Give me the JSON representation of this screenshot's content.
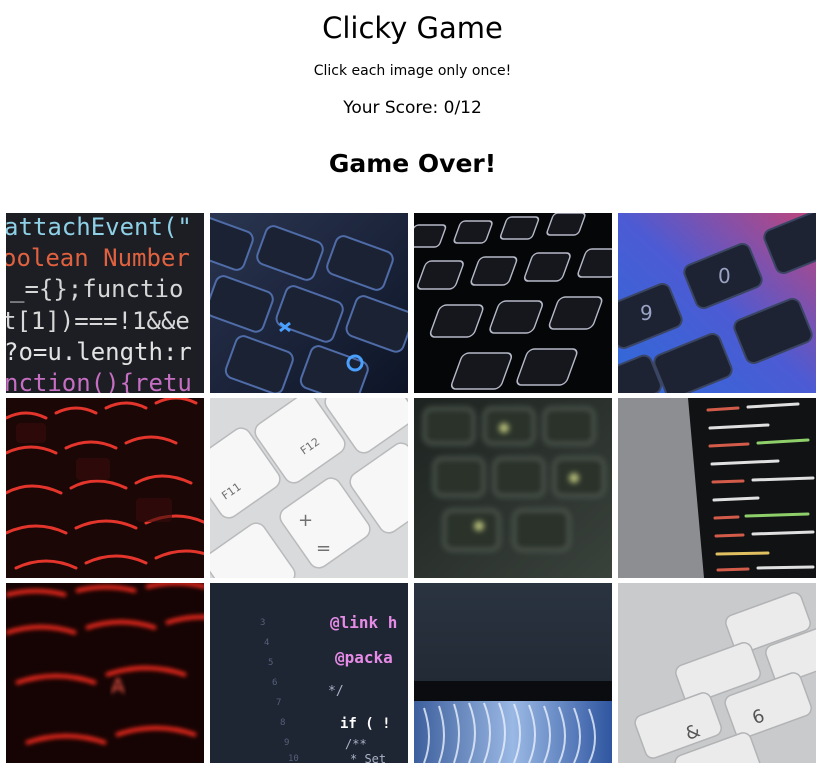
{
  "header": {
    "title": "Clicky Game",
    "subtitle": "Click each image only once!",
    "score": "Your Score: 0/12",
    "status": "Game Over!"
  },
  "tiles": [
    {
      "name": "code-closeup-image-tile",
      "code_lines": [
        "attachEvent(\"",
        "oolean Number",
        "_={};functio",
        "t[1])===!1&&e",
        "?o=u.length:r",
        "nction(){retu"
      ]
    },
    {
      "name": "blue-keyboard-image-tile"
    },
    {
      "name": "dark-backlit-keyboard-image-tile"
    },
    {
      "name": "purple-keyboard-image-tile",
      "keys": [
        "9",
        "0"
      ]
    },
    {
      "name": "red-keyboard-image-tile"
    },
    {
      "name": "white-keyboard-image-tile",
      "keys": [
        "F11",
        "F12",
        "+",
        "="
      ]
    },
    {
      "name": "blurred-keyboard-image-tile"
    },
    {
      "name": "code-on-laptop-image-tile"
    },
    {
      "name": "red-glow-keyboard-image-tile",
      "keys": [
        "A"
      ]
    },
    {
      "name": "code-editor-image-tile",
      "code_lines": [
        "@link h",
        "@packa",
        "*/",
        "if ( !",
        "/**",
        "* Set"
      ]
    },
    {
      "name": "monitor-wallpaper-image-tile"
    },
    {
      "name": "silver-keyboard-image-tile",
      "keys": [
        "&",
        "6"
      ]
    }
  ],
  "colors": {
    "background": "#ffffff",
    "text": "#000000"
  }
}
